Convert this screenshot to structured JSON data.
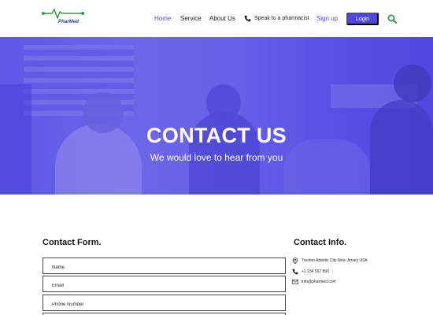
{
  "brand": {
    "name": "PharMed",
    "primary_color": "#4f46e5",
    "logo_green": "#2e9a3a"
  },
  "nav": {
    "home": "Home",
    "service": "Service",
    "about": "About Us",
    "pharmacist": "Speak to a pharmacist",
    "signup": "Sign up",
    "login": "Login",
    "search_icon": "search-icon"
  },
  "hero": {
    "title": "CONTACT US",
    "subtitle": "We would love to hear from you"
  },
  "contact_form": {
    "title": "Contact Form.",
    "fields": [
      {
        "placeholder": "Name"
      },
      {
        "placeholder": "Email"
      },
      {
        "placeholder": "Phone Number"
      },
      {
        "placeholder": ""
      }
    ]
  },
  "contact_info": {
    "title": "Contact Info.",
    "address": "Trenton Atlantic City New Jersey USA",
    "phone": "+1 234 567 890",
    "email": "info@pharmed.com"
  }
}
